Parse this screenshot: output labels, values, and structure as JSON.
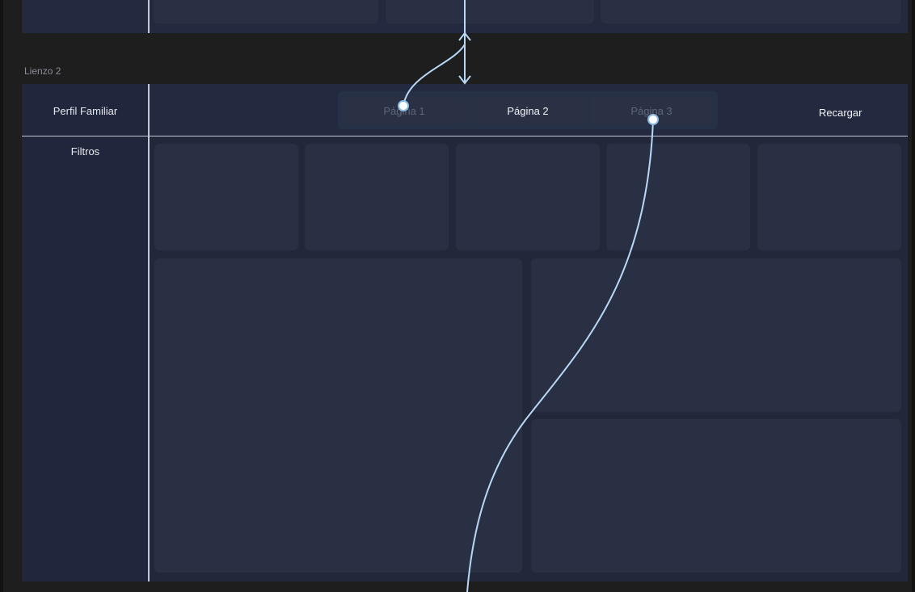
{
  "canvas2": {
    "label": "Lienzo 2",
    "header": {
      "title": "Perfil Familiar",
      "tabs": [
        "Página 1",
        "Página 2",
        "Página 3"
      ],
      "active_tab": "Página 2",
      "reload_label": "Recargar"
    },
    "sidebar": {
      "filters_label": "Filtros"
    }
  },
  "colors": {
    "app_background": "#1e1e1e",
    "canvas_background": "#232a40",
    "card_background": "#2a3043",
    "connector": "#b8d8f5",
    "divider": "#c2c8d6"
  }
}
